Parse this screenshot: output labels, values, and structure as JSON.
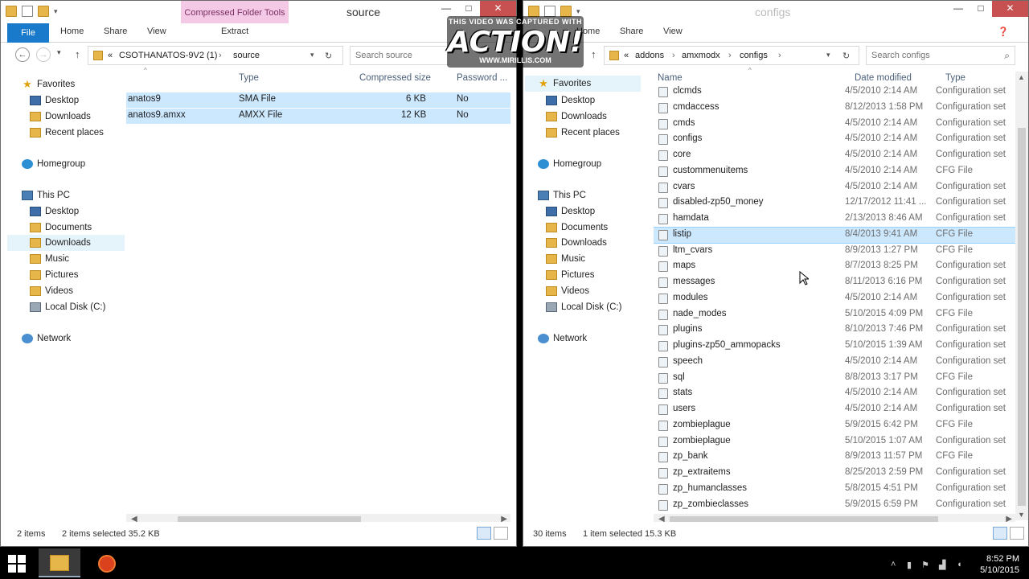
{
  "left": {
    "title": "source",
    "context_tab": "Compressed Folder Tools",
    "tabs": [
      "File",
      "Home",
      "Share",
      "View",
      "Extract"
    ],
    "breadcrumb": [
      "CSOTHANATOS-9V2 (1)",
      "source"
    ],
    "breadcrumb_prefix": "«",
    "search_placeholder": "Search source",
    "columns": [
      "Type",
      "Compressed size",
      "Password ..."
    ],
    "rows": [
      {
        "name": "anatos9",
        "type": "SMA File",
        "size": "6 KB",
        "password": "No"
      },
      {
        "name": "anatos9.amxx",
        "type": "AMXX File",
        "size": "12 KB",
        "password": "No"
      }
    ],
    "nav": {
      "favorites": "Favorites",
      "fav_items": [
        "Desktop",
        "Downloads",
        "Recent places"
      ],
      "homegroup": "Homegroup",
      "thispc": "This PC",
      "pc_items": [
        "Desktop",
        "Documents",
        "Downloads",
        "Music",
        "Pictures",
        "Videos",
        "Local Disk (C:)"
      ],
      "network": "Network"
    },
    "status": {
      "items": "2 items",
      "selected": "2 items selected  35.2 KB"
    }
  },
  "right": {
    "title": "configs",
    "tabs": [
      "Home",
      "Share",
      "View"
    ],
    "breadcrumb": [
      "addons",
      "amxmodx",
      "configs"
    ],
    "breadcrumb_prefix": "«",
    "search_placeholder": "Search configs",
    "columns": [
      "Name",
      "Date modified",
      "Type"
    ],
    "rows": [
      {
        "name": "clcmds",
        "date": "4/5/2010 2:14 AM",
        "type": "Configuration set"
      },
      {
        "name": "cmdaccess",
        "date": "8/12/2013 1:58 PM",
        "type": "Configuration set"
      },
      {
        "name": "cmds",
        "date": "4/5/2010 2:14 AM",
        "type": "Configuration set"
      },
      {
        "name": "configs",
        "date": "4/5/2010 2:14 AM",
        "type": "Configuration set"
      },
      {
        "name": "core",
        "date": "4/5/2010 2:14 AM",
        "type": "Configuration set"
      },
      {
        "name": "custommenuitems",
        "date": "4/5/2010 2:14 AM",
        "type": "CFG File"
      },
      {
        "name": "cvars",
        "date": "4/5/2010 2:14 AM",
        "type": "Configuration set"
      },
      {
        "name": "disabled-zp50_money",
        "date": "12/17/2012 11:41 ...",
        "type": "Configuration set"
      },
      {
        "name": "hamdata",
        "date": "2/13/2013 8:46 AM",
        "type": "Configuration set"
      },
      {
        "name": "listip",
        "date": "8/4/2013 9:41 AM",
        "type": "CFG File"
      },
      {
        "name": "ltm_cvars",
        "date": "8/9/2013 1:27 PM",
        "type": "CFG File"
      },
      {
        "name": "maps",
        "date": "8/7/2013 8:25 PM",
        "type": "Configuration set"
      },
      {
        "name": "messages",
        "date": "8/11/2013 6:16 PM",
        "type": "Configuration set"
      },
      {
        "name": "modules",
        "date": "4/5/2010 2:14 AM",
        "type": "Configuration set"
      },
      {
        "name": "nade_modes",
        "date": "5/10/2015 4:09 PM",
        "type": "CFG File"
      },
      {
        "name": "plugins",
        "date": "8/10/2013 7:46 PM",
        "type": "Configuration set"
      },
      {
        "name": "plugins-zp50_ammopacks",
        "date": "5/10/2015 1:39 AM",
        "type": "Configuration set"
      },
      {
        "name": "speech",
        "date": "4/5/2010 2:14 AM",
        "type": "Configuration set"
      },
      {
        "name": "sql",
        "date": "8/8/2013 3:17 PM",
        "type": "CFG File"
      },
      {
        "name": "stats",
        "date": "4/5/2010 2:14 AM",
        "type": "Configuration set"
      },
      {
        "name": "users",
        "date": "4/5/2010 2:14 AM",
        "type": "Configuration set"
      },
      {
        "name": "zombieplague",
        "date": "5/9/2015 6:42 PM",
        "type": "CFG File"
      },
      {
        "name": "zombieplague",
        "date": "5/10/2015 1:07 AM",
        "type": "Configuration set"
      },
      {
        "name": "zp_bank",
        "date": "8/9/2013 11:57 PM",
        "type": "CFG File"
      },
      {
        "name": "zp_extraitems",
        "date": "8/25/2013 2:59 PM",
        "type": "Configuration set"
      },
      {
        "name": "zp_humanclasses",
        "date": "5/8/2015 4:51 PM",
        "type": "Configuration set"
      },
      {
        "name": "zp_zombieclasses",
        "date": "5/9/2015 6:59 PM",
        "type": "Configuration set"
      }
    ],
    "selected_row": "listip",
    "nav": {
      "favorites": "Favorites",
      "fav_items": [
        "Desktop",
        "Downloads",
        "Recent places"
      ],
      "homegroup": "Homegroup",
      "thispc": "This PC",
      "pc_items": [
        "Desktop",
        "Documents",
        "Downloads",
        "Music",
        "Pictures",
        "Videos",
        "Local Disk (C:)"
      ],
      "network": "Network"
    },
    "status": {
      "items": "30 items",
      "selected": "1 item selected  15.3 KB"
    }
  },
  "watermark": {
    "top": "THIS VIDEO WAS CAPTURED WITH",
    "logo": "ACTION!",
    "url": "WWW.MIRILLIS.COM"
  },
  "taskbar": {
    "time": "8:52 PM",
    "date": "5/10/2015"
  },
  "colors": {
    "accent": "#1979ca",
    "selection": "#cce8ff",
    "context_tab": "#f4c9e6"
  }
}
